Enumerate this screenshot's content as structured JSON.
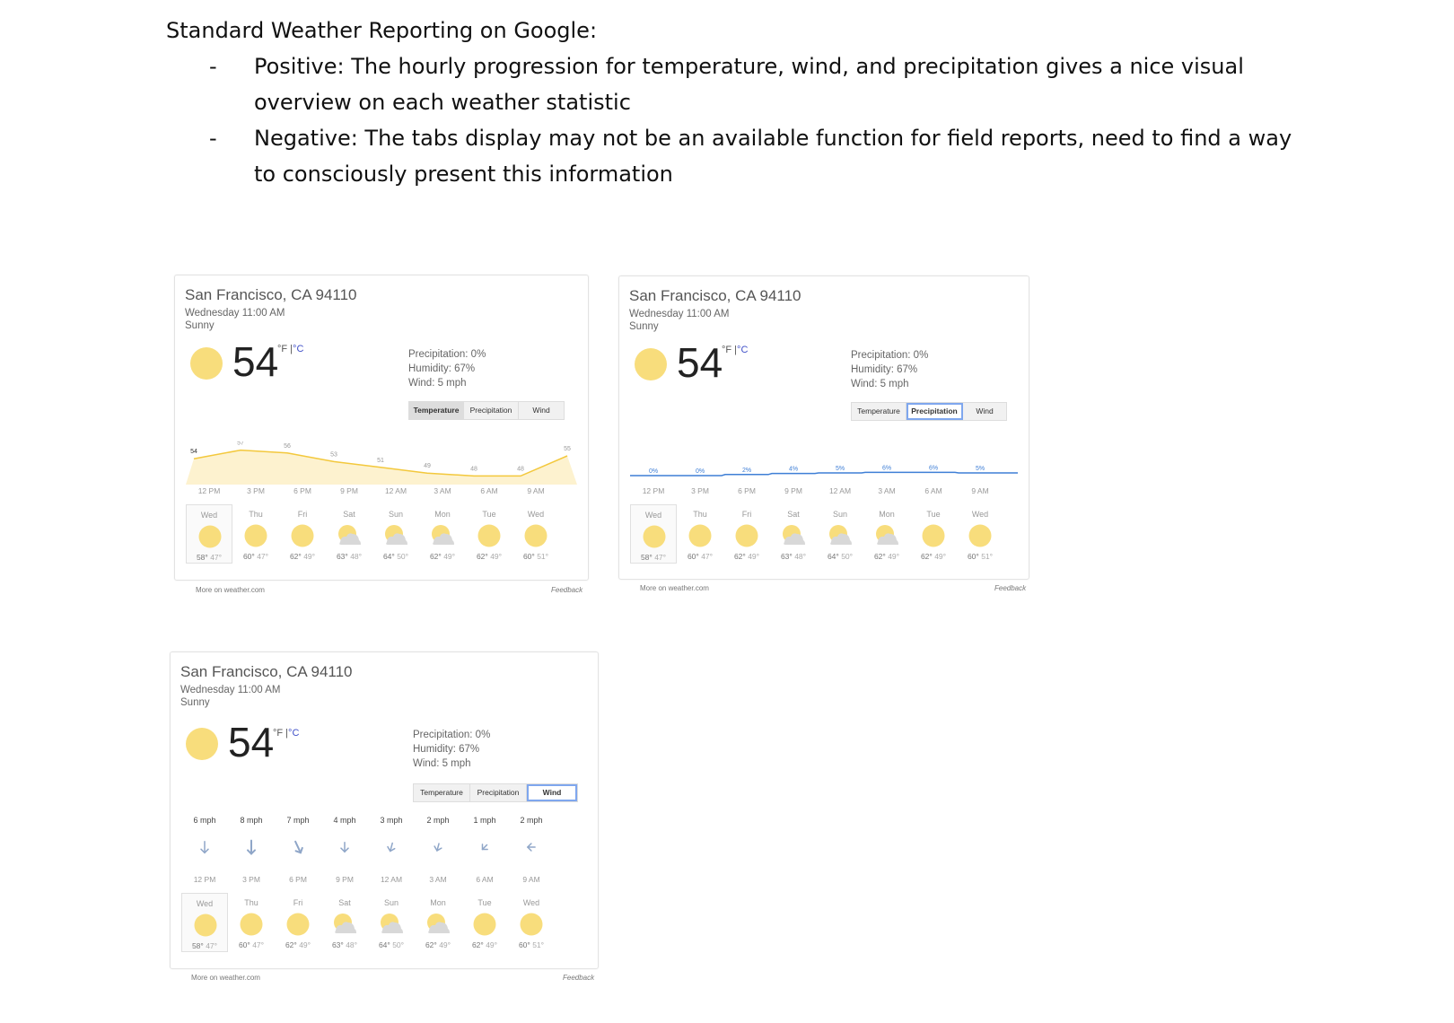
{
  "doc": {
    "heading": "Standard Weather Reporting on Google:",
    "bullets": [
      {
        "dash": "-",
        "line1": "Positive: The hourly progression for temperature, wind, and precipitation gives a nice visual",
        "line2": "overview on each weather statistic"
      },
      {
        "dash": "-",
        "line1": "Negative: The tabs display may not be an available function for field reports, need to find a way",
        "line2": "to consciously present this information"
      }
    ]
  },
  "weather": {
    "location": "San Francisco, CA 94110",
    "datetime": "Wednesday 11:00 AM",
    "condition": "Sunny",
    "temperature": "54",
    "unit_f": "°F |",
    "unit_c": "°C",
    "precipitation": "Precipitation: 0%",
    "humidity": "Humidity: 67%",
    "wind": "Wind: 5 mph",
    "tabs": [
      "Temperature",
      "Precipitation",
      "Wind"
    ],
    "hours": [
      "12 PM",
      "3 PM",
      "6 PM",
      "9 PM",
      "12 AM",
      "3 AM",
      "6 AM",
      "9 AM"
    ],
    "temp_values": [
      "54",
      "57",
      "56",
      "53",
      "51",
      "49",
      "48",
      "48",
      "55"
    ],
    "precip_values": [
      "0%",
      "0%",
      "2%",
      "4%",
      "5%",
      "6%",
      "6%",
      "5%"
    ],
    "wind_values": [
      "6 mph",
      "8 mph",
      "7 mph",
      "4 mph",
      "3 mph",
      "2 mph",
      "1 mph",
      "2 mph"
    ],
    "days": [
      {
        "name": "Wed",
        "icon": "sun-icon",
        "high": "58°",
        "low": "47°"
      },
      {
        "name": "Thu",
        "icon": "sun-icon",
        "high": "60°",
        "low": "47°"
      },
      {
        "name": "Fri",
        "icon": "sun-icon",
        "high": "62°",
        "low": "49°"
      },
      {
        "name": "Sat",
        "icon": "partly-cloudy-icon",
        "high": "63°",
        "low": "48°"
      },
      {
        "name": "Sun",
        "icon": "partly-cloudy-icon",
        "high": "64°",
        "low": "50°"
      },
      {
        "name": "Mon",
        "icon": "partly-cloudy-icon",
        "high": "62°",
        "low": "49°"
      },
      {
        "name": "Tue",
        "icon": "sun-icon",
        "high": "62°",
        "low": "49°"
      },
      {
        "name": "Wed",
        "icon": "sun-icon",
        "high": "60°",
        "low": "51°"
      }
    ],
    "more_link": "More on weather.com",
    "feedback": "Feedback"
  },
  "colors": {
    "sun": "#f8dd7c",
    "temp_line": "#f3c83c",
    "temp_fill": "#fdf2cf",
    "precip_line": "#3f7fd6"
  }
}
